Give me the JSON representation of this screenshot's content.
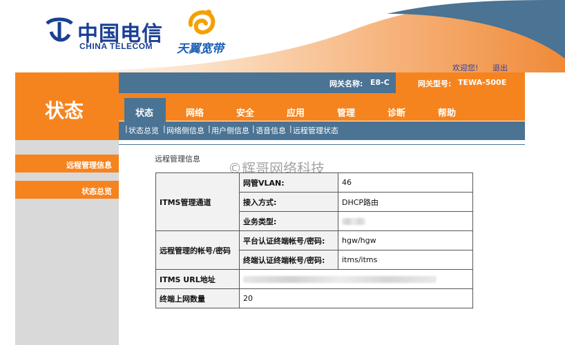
{
  "brand": {
    "ct_cn": "中国电信",
    "ct_en": "CHINA TELECOM",
    "tianyi": "天翼宽带"
  },
  "header": {
    "welcome": "欢迎您!",
    "logout": "退出",
    "gateway_name_label": "网关名称:",
    "gateway_name_value": "E8-C",
    "gateway_type_label": "网关型号:",
    "gateway_type_value": "TEWA-500E"
  },
  "left_title": "状态",
  "nav": {
    "tabs": [
      "状态",
      "网络",
      "安全",
      "应用",
      "管理",
      "诊断",
      "帮助"
    ],
    "active": 0
  },
  "subnav": [
    "状态总览",
    "网络侧信息",
    "用户侧信息",
    "语音信息",
    "远程管理状态"
  ],
  "sidebar": [
    "远程管理信息",
    "状态总览"
  ],
  "section_title": "远程管理信息",
  "watermark": "©辉哥网络科技",
  "table": {
    "itms_group": "ITMS管理通道",
    "vlan_label": "网管VLAN:",
    "vlan_value": "46",
    "access_label": "接入方式:",
    "access_value": "DHCP路由",
    "service_label": "业务类型:",
    "account_group": "远程管理的帐号/密码",
    "platform_label": "平台认证终端帐号/密码:",
    "platform_value": "hgw/hgw",
    "terminal_label": "终端认证终端帐号/密码:",
    "terminal_value": "itms/itms",
    "url_label": "ITMS URL地址",
    "online_label": "终端上网数量",
    "online_value": "20"
  },
  "colors": {
    "orange": "#f5841f",
    "steel_blue": "#4a7394",
    "telecom_blue": "#1b3f94"
  }
}
